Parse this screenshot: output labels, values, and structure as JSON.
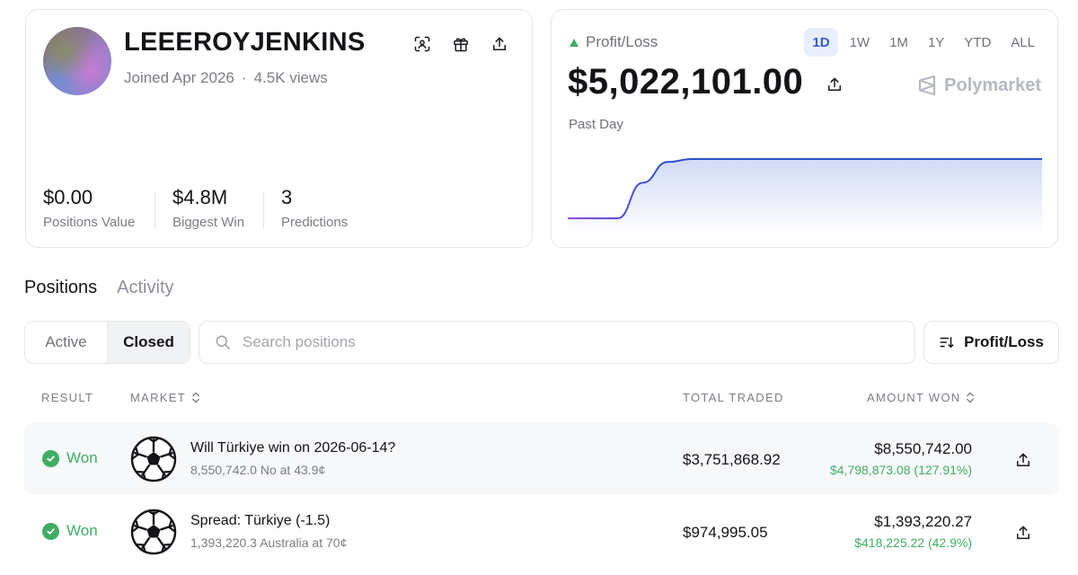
{
  "profile": {
    "username": "LEEEROYJENKINS",
    "joined": "Joined Apr 2026",
    "separator": "·",
    "views": "4.5K views",
    "stats": [
      {
        "value": "$0.00",
        "label": "Positions Value"
      },
      {
        "value": "$4.8M",
        "label": "Biggest Win"
      },
      {
        "value": "3",
        "label": "Predictions"
      }
    ]
  },
  "pnl": {
    "label": "Profit/Loss",
    "value": "$5,022,101.00",
    "period_label": "Past Day",
    "brand": "Polymarket",
    "ranges": [
      "1D",
      "1W",
      "1M",
      "1Y",
      "YTD",
      "ALL"
    ],
    "active_range": "1D",
    "accent_color": "#2e5bd7",
    "up_color": "#3fae63",
    "chart_data": {
      "type": "line",
      "series": [
        {
          "values": [
            0,
            0,
            0,
            0.6,
            0.95,
            1,
            1,
            1,
            1,
            1,
            1,
            1,
            1,
            1,
            1,
            1,
            1,
            1,
            1,
            1
          ]
        }
      ],
      "line_color_start": "#8a4fd6",
      "line_color_end": "#2e4fcf"
    }
  },
  "tabs": {
    "positions": "Positions",
    "activity": "Activity"
  },
  "filters": {
    "active": "Active",
    "closed": "Closed",
    "search_placeholder": "Search positions",
    "sort_label": "Profit/Loss"
  },
  "table": {
    "headers": {
      "result": "RESULT",
      "market": "MARKET",
      "total_traded": "TOTAL TRADED",
      "amount_won": "AMOUNT WON"
    },
    "rows": [
      {
        "result": "Won",
        "icon": "soccer-ball-icon",
        "title": "Will Türkiye win on 2026-06-14?",
        "subtitle": "8,550,742.0 No at 43.9¢",
        "total_traded": "$3,751,868.92",
        "amount_won": "$8,550,742.00",
        "gain": "$4,798,873.08 (127.91%)"
      },
      {
        "result": "Won",
        "icon": "soccer-ball-icon",
        "title": "Spread: Türkiye (-1.5)",
        "subtitle": "1,393,220.3 Australia at 70¢",
        "total_traded": "$974,995.05",
        "amount_won": "$1,393,220.27",
        "gain": "$418,225.22 (42.9%)"
      }
    ]
  }
}
